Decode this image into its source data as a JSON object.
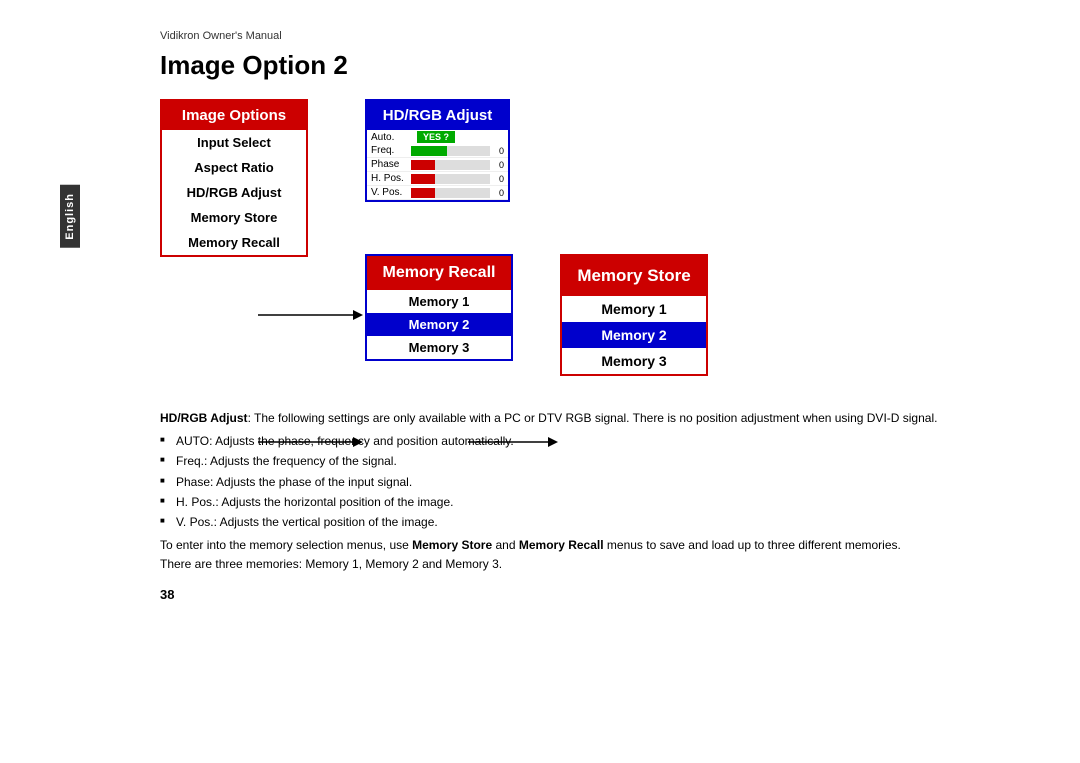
{
  "meta": {
    "manual_label": "Vidikron Owner's Manual",
    "page_title": "Image Option 2",
    "page_number": "38",
    "english_tab": "English"
  },
  "diagram": {
    "image_options": {
      "header": "Image Options",
      "items": [
        "Input Select",
        "Aspect Ratio",
        "HD/RGB Adjust",
        "Memory Store",
        "Memory Recall"
      ]
    },
    "hd_rgb": {
      "header": "HD/RGB Adjust",
      "rows": [
        {
          "label": "Auto.",
          "type": "yes",
          "value": "YES ?"
        },
        {
          "label": "Freq.",
          "type": "bar",
          "fill": 0.4,
          "color": "green",
          "val": "0"
        },
        {
          "label": "Phase",
          "type": "bar",
          "fill": 0.3,
          "color": "red",
          "val": "0"
        },
        {
          "label": "H. Pos.",
          "type": "bar",
          "fill": 0.3,
          "color": "red",
          "val": "0"
        },
        {
          "label": "V. Pos.",
          "type": "bar",
          "fill": 0.3,
          "color": "red",
          "val": "0"
        }
      ]
    },
    "memory_recall": {
      "header": "Memory Recall",
      "items": [
        {
          "label": "Memory 1",
          "highlighted": false
        },
        {
          "label": "Memory 2",
          "highlighted": true
        },
        {
          "label": "Memory 3",
          "highlighted": false
        }
      ]
    },
    "memory_store": {
      "header": "Memory Store",
      "items": [
        {
          "label": "Memory 1",
          "highlighted": false
        },
        {
          "label": "Memory 2",
          "highlighted": true
        },
        {
          "label": "Memory 3",
          "highlighted": false
        }
      ]
    }
  },
  "description": {
    "intro": "HD/RGB Adjust",
    "intro_text": ":  The following settings are only available with a PC or DTV RGB signal. There is no position adjustment when using DVI-D signal.",
    "bullets": [
      "AUTO: Adjusts the phase, frequency and position automatically.",
      "Freq.: Adjusts the frequency of the signal.",
      "Phase: Adjusts the phase of the input signal.",
      "H. Pos.: Adjusts the horizontal position of the image.",
      "V. Pos.: Adjusts the vertical position of the image."
    ],
    "memory_note": "To enter into the memory selection menus, use ",
    "memory_note_store": "Memory Store",
    "memory_note_and": " and ",
    "memory_note_recall": "Memory Recall",
    "memory_note_end": " menus to save and load up to three different memories.",
    "memory_note2": "There are three memories: Memory 1, Memory 2 and Memory 3."
  }
}
